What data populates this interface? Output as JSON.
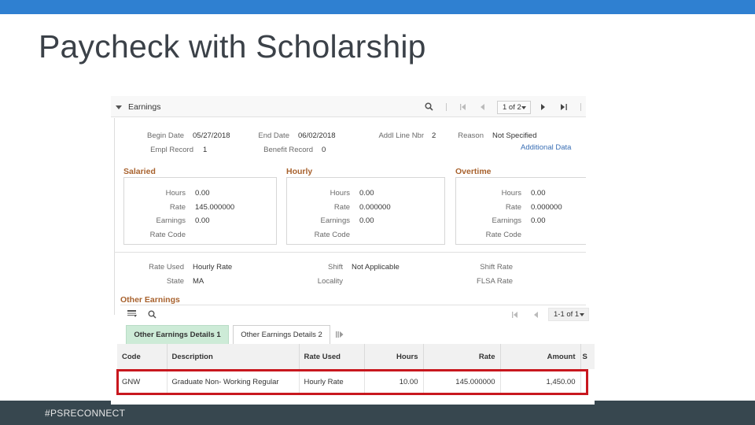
{
  "slide": {
    "title": "Paycheck with Scholarship",
    "footer_tag": "#PSRECONNECT"
  },
  "colors": {
    "topbar": "#2f80d1",
    "footer": "#37474f",
    "section_title": "#a8622e",
    "active_tab": "#cdebd7",
    "highlight": "#c8171e",
    "link": "#3a6fb5"
  },
  "earnings": {
    "header": "Earnings",
    "pager": "1 of 2",
    "icons": [
      "search-icon",
      "first-page-icon",
      "previous-page-icon",
      "next-page-icon",
      "last-page-icon"
    ],
    "begin_date": {
      "label": "Begin Date",
      "value": "05/27/2018"
    },
    "end_date": {
      "label": "End Date",
      "value": "06/02/2018"
    },
    "addl_line_nbr": {
      "label": "Addl Line Nbr",
      "value": "2"
    },
    "reason": {
      "label": "Reason",
      "value": "Not Specified"
    },
    "empl_record": {
      "label": "Empl Record",
      "value": "1"
    },
    "benefit_record": {
      "label": "Benefit Record",
      "value": "0"
    },
    "additional_data_link": "Additional Data",
    "groups": [
      {
        "title": "Salaried",
        "rows": [
          {
            "label": "Hours",
            "value": "0.00"
          },
          {
            "label": "Rate",
            "value": "145.000000"
          },
          {
            "label": "Earnings",
            "value": "0.00"
          },
          {
            "label": "Rate Code",
            "value": ""
          }
        ]
      },
      {
        "title": "Hourly",
        "rows": [
          {
            "label": "Hours",
            "value": "0.00"
          },
          {
            "label": "Rate",
            "value": "0.000000"
          },
          {
            "label": "Earnings",
            "value": "0.00"
          },
          {
            "label": "Rate Code",
            "value": ""
          }
        ]
      },
      {
        "title": "Overtime",
        "rows": [
          {
            "label": "Hours",
            "value": "0.00"
          },
          {
            "label": "Rate",
            "value": "0.000000"
          },
          {
            "label": "Earnings",
            "value": "0.00"
          },
          {
            "label": "Rate Code",
            "value": ""
          }
        ]
      }
    ],
    "rate_used": {
      "label": "Rate Used",
      "value": "Hourly Rate"
    },
    "state": {
      "label": "State",
      "value": "MA"
    },
    "shift": {
      "label": "Shift",
      "value": "Not Applicable"
    },
    "locality": {
      "label": "Locality",
      "value": ""
    },
    "shift_rate": {
      "label": "Shift Rate",
      "value": ""
    },
    "flsa_rate": {
      "label": "FLSA Rate",
      "value": ""
    }
  },
  "other_earnings": {
    "title": "Other Earnings",
    "pager": "1-1 of 1",
    "tabs": [
      {
        "label": "Other Earnings Details 1",
        "active": true
      },
      {
        "label": "Other Earnings Details 2",
        "active": false
      }
    ],
    "columns": [
      "Code",
      "Description",
      "Rate Used",
      "Hours",
      "Rate",
      "Amount",
      "S"
    ],
    "rows": [
      {
        "code": "GNW",
        "description": "Graduate Non- Working Regular",
        "rate_used": "Hourly Rate",
        "hours": "10.00",
        "rate": "145.000000",
        "amount": "1,450.00",
        "extra": ""
      }
    ],
    "highlighted_row": 0
  }
}
